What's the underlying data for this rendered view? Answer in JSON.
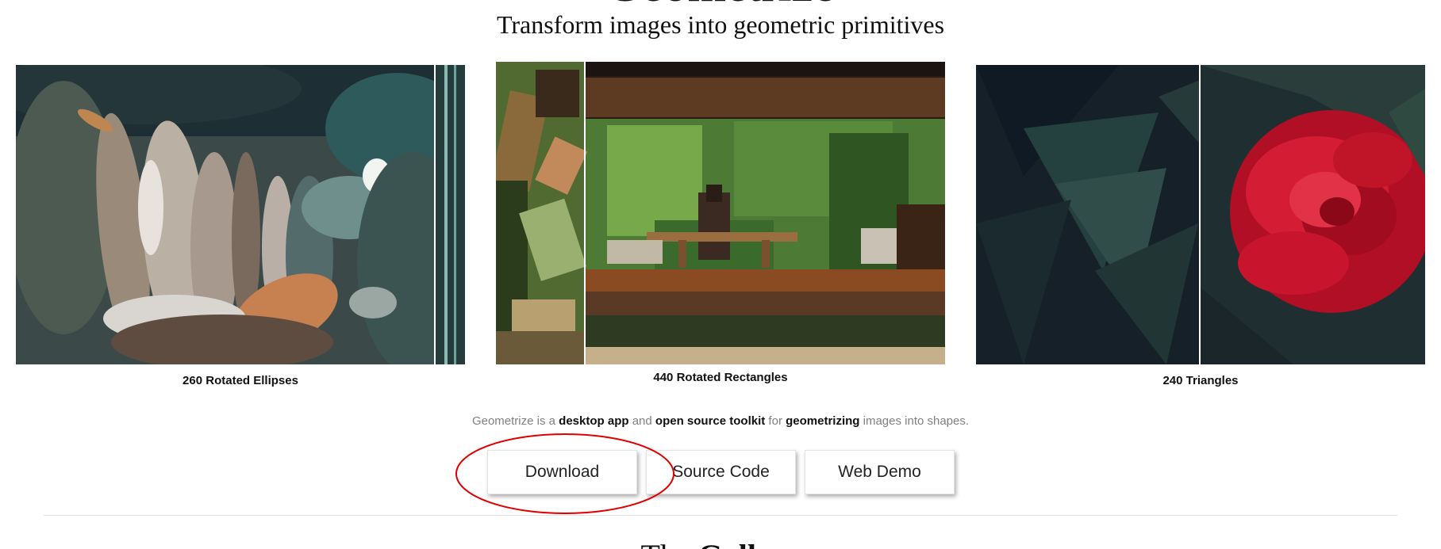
{
  "header": {
    "title": "Geometrize",
    "subtitle": "Transform images into geometric primitives"
  },
  "gallery": [
    {
      "caption": "260 Rotated Ellipses"
    },
    {
      "caption": "440 Rotated Rectangles"
    },
    {
      "caption": "240 Triangles"
    }
  ],
  "description": {
    "t1": "Geometrize is a ",
    "b1": "desktop app",
    "t2": " and ",
    "b2": "open source toolkit",
    "t3": " for ",
    "b3": "geometrizing",
    "t4": " images into shapes."
  },
  "buttons": {
    "download": "Download",
    "source": "Source Code",
    "demo": "Web Demo"
  },
  "section": {
    "title_plain": "The ",
    "title_bold": "Gallery"
  },
  "colors": {
    "annotation": "#e00000",
    "caption_text": "#111111",
    "description_text": "#808080"
  }
}
